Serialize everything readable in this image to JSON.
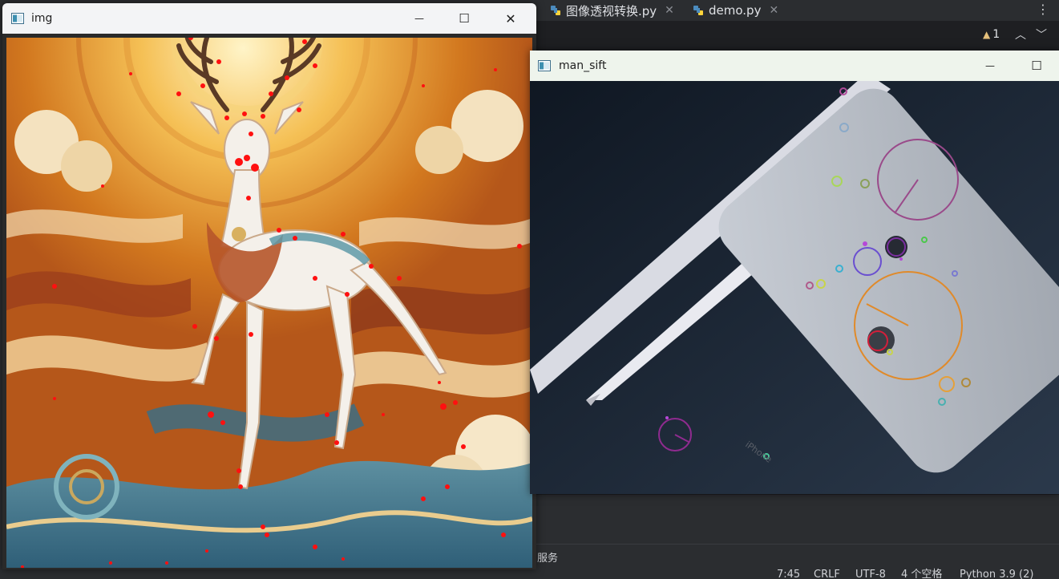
{
  "ide": {
    "tabs": [
      {
        "label": "图像透视转换.py",
        "close": "✕"
      },
      {
        "label": "demo.py",
        "close": "✕"
      }
    ],
    "more_menu": "⋮",
    "warning_count": "1",
    "services_label": "服务",
    "status": {
      "position": "7:45",
      "line_ending": "CRLF",
      "encoding": "UTF-8",
      "indent": "4 个空格",
      "interpreter": "Python 3.9 (2)"
    }
  },
  "windows": {
    "img": {
      "title": "img",
      "controls": {
        "minimize": "—",
        "maximize": "☐",
        "close": "✕"
      }
    },
    "man_sift": {
      "title": "man_sift",
      "controls": {
        "minimize": "—",
        "maximize": "☐"
      }
    }
  },
  "colors": {
    "keypoint_red": "#ff1010",
    "warm_orange": "#e08a2a",
    "sift_background": "#1c2633"
  }
}
